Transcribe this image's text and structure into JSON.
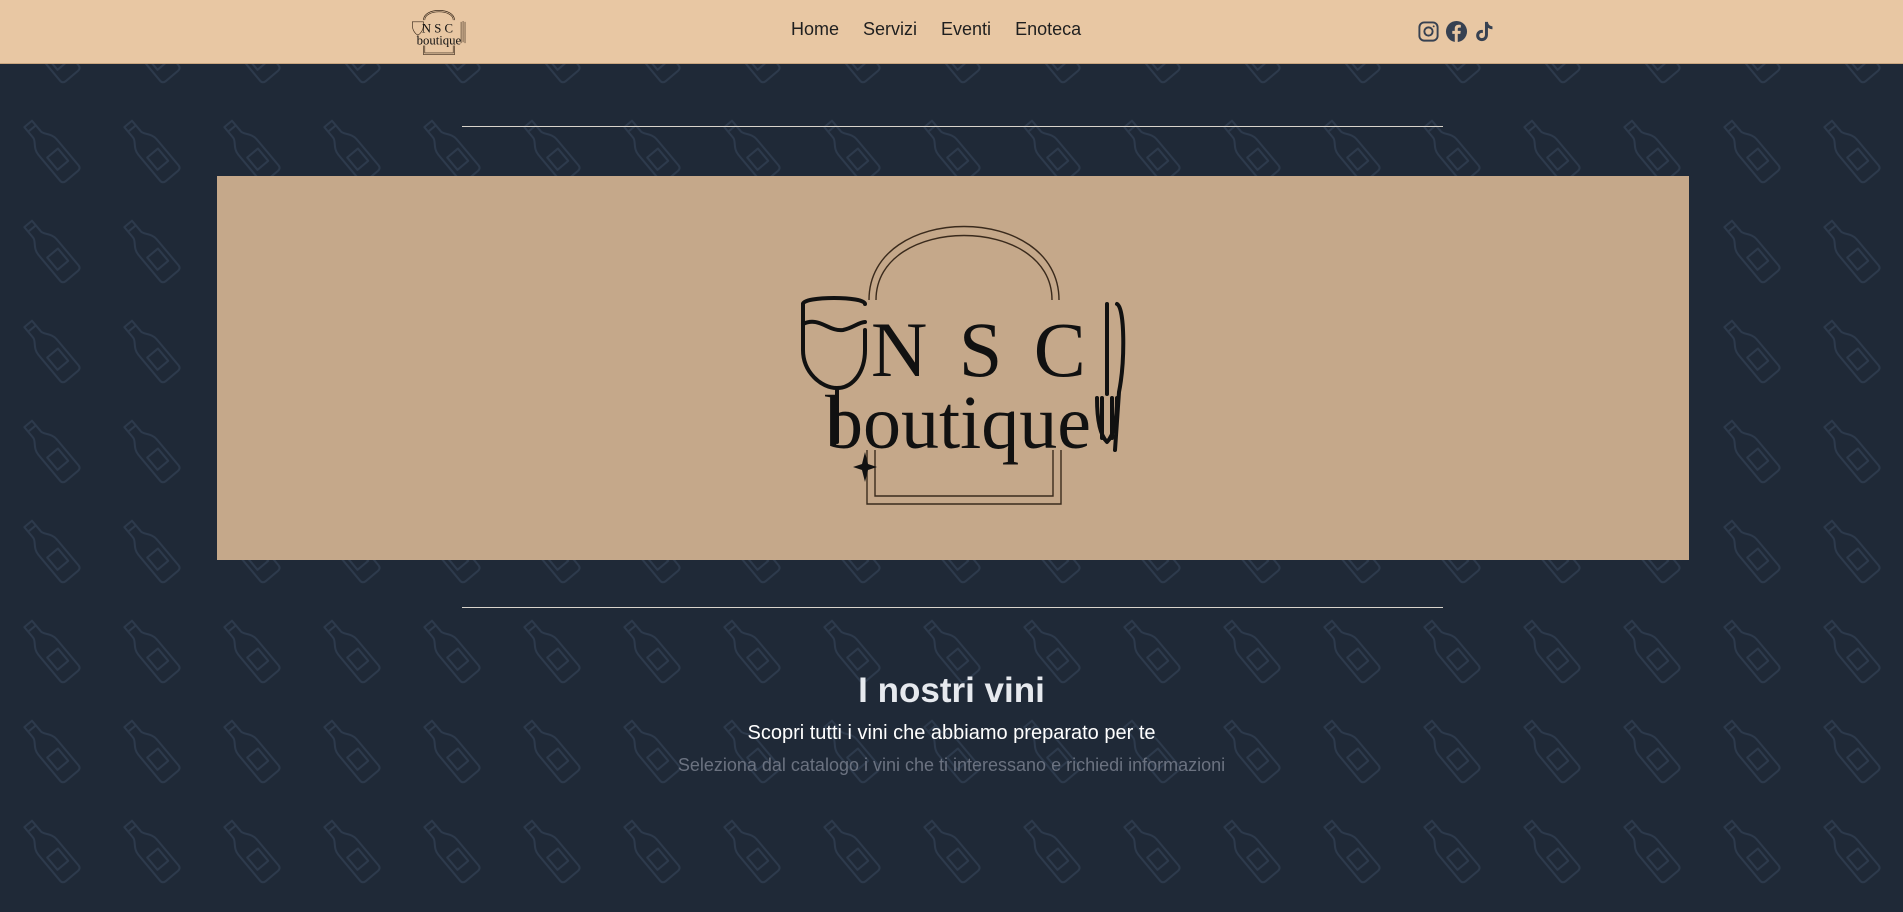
{
  "brand": {
    "logo_line1": "N S C",
    "logo_line2": "boutique"
  },
  "nav": {
    "items": [
      {
        "label": "Home"
      },
      {
        "label": "Servizi"
      },
      {
        "label": "Eventi"
      },
      {
        "label": "Enoteca"
      }
    ]
  },
  "social": {
    "icons": [
      "instagram-icon",
      "facebook-icon",
      "tiktok-icon"
    ]
  },
  "section": {
    "title": "I nostri vini",
    "subtitle": "Scopri tutti i vini che abbiamo preparato per te",
    "hint": "Seleziona dal catalogo i vini che ti interessano e richiedi informazioni"
  },
  "colors": {
    "navbar": "#e8c7a3",
    "page_bg": "#1f2937",
    "hero_bg": "#c5a88a",
    "pattern": "#2d3a4c"
  }
}
